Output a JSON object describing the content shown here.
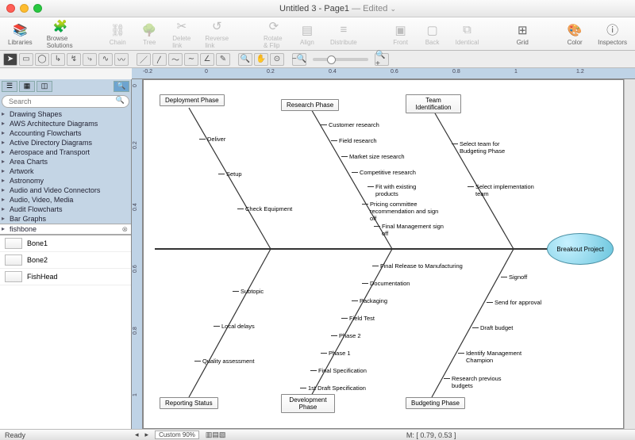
{
  "window": {
    "title": "Untitled 3 - Page1",
    "edited": "— Edited",
    "dropdown_glyph": "⌄"
  },
  "toolbar": [
    {
      "name": "libraries",
      "label": "Libraries",
      "glyph": "📚",
      "dis": false
    },
    {
      "name": "browse",
      "label": "Browse Solutions",
      "glyph": "🧩",
      "dis": false
    },
    {
      "name": "chain",
      "label": "Chain",
      "glyph": "⛓",
      "dis": true,
      "spacer_before": true
    },
    {
      "name": "tree",
      "label": "Tree",
      "glyph": "🌳",
      "dis": true
    },
    {
      "name": "delete-link",
      "label": "Delete link",
      "glyph": "✂",
      "dis": true
    },
    {
      "name": "reverse-link",
      "label": "Reverse link",
      "glyph": "↺",
      "dis": true
    },
    {
      "name": "rotate",
      "label": "Rotate & Flip",
      "glyph": "⟳",
      "dis": true,
      "spacer_before": true
    },
    {
      "name": "align",
      "label": "Align",
      "glyph": "▤",
      "dis": true
    },
    {
      "name": "distribute",
      "label": "Distribute",
      "glyph": "≡",
      "dis": true
    },
    {
      "name": "front",
      "label": "Front",
      "glyph": "▣",
      "dis": true,
      "spacer_before": true
    },
    {
      "name": "back",
      "label": "Back",
      "glyph": "▢",
      "dis": true
    },
    {
      "name": "identical",
      "label": "Identical",
      "glyph": "⧉",
      "dis": true
    },
    {
      "name": "grid",
      "label": "Grid",
      "glyph": "⊞",
      "dis": false,
      "spacer_before": true
    },
    {
      "name": "color",
      "label": "Color",
      "glyph": "🎨",
      "dis": false,
      "spacer_before": true
    },
    {
      "name": "inspectors",
      "label": "Inspectors",
      "glyph": "ⓘ",
      "dis": false
    }
  ],
  "sidebar": {
    "search_placeholder": "Search",
    "categories": [
      "Drawing Shapes",
      "AWS Architecture Diagrams",
      "Accounting Flowcharts",
      "Active Directory Diagrams",
      "Aerospace and Transport",
      "Area Charts",
      "Artwork",
      "Astronomy",
      "Audio and Video Connectors",
      "Audio, Video, Media",
      "Audit Flowcharts",
      "Bar Graphs"
    ],
    "selected": "fishbone",
    "shapes": [
      "Bone1",
      "Bone2",
      "FishHead"
    ]
  },
  "ruler_h": [
    "-0.2",
    "0",
    "0.2",
    "0.4",
    "0.6",
    "0.8",
    "1",
    "1.2"
  ],
  "ruler_v": [
    "0",
    "0.2",
    "0.4",
    "0.6",
    "0.8",
    "1"
  ],
  "diagram": {
    "head": "Breakout Project",
    "categories_top": [
      "Deployment Phase",
      "Research Phase",
      "Team Identification"
    ],
    "categories_bottom": [
      "Reporting Status",
      "Development Phase",
      "Budgeting Phase"
    ],
    "bones": {
      "deployment": [
        "Deliver",
        "Setup",
        "Check Equipment"
      ],
      "research": [
        "Customer research",
        "Field research",
        "Market size research",
        "Competitive research",
        "Fit with existing products",
        "Pricing committee recommendation and sign off",
        "Final Management sign off"
      ],
      "team": [
        "Select team for Budgeting Phase",
        "Select implementation team"
      ],
      "reporting": [
        "Subtopic",
        "Local delays",
        "Quality assessment"
      ],
      "development": [
        "Final Release to Manufacturing",
        "Documentation",
        "Packaging",
        "Field Test",
        "Phase 2",
        "Phase 1",
        "Final Specification",
        "1st Draft Specification"
      ],
      "budgeting": [
        "Signoff",
        "Send for approval",
        "Draft budget",
        "Identify Management Champion",
        "Research previous budgets"
      ]
    }
  },
  "status": {
    "ready": "Ready",
    "zoom": "Custom 90%",
    "mouse": "M: [ 0.79, 0.53 ]"
  }
}
